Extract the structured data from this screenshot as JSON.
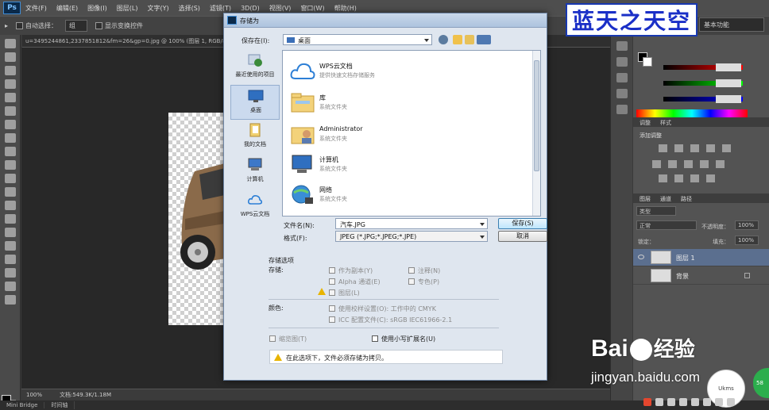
{
  "ps": {
    "menu": [
      "文件(F)",
      "编辑(E)",
      "图像(I)",
      "图层(L)",
      "文字(Y)",
      "选择(S)",
      "滤镜(T)",
      "3D(D)",
      "视图(V)",
      "窗口(W)",
      "帮助(H)"
    ],
    "options": {
      "auto_select": "自动选择：",
      "auto_select_value": "组",
      "show_transform": "显示变换控件"
    },
    "workspace": "基本功能",
    "doc_tab": "u=3495244861,2337851812&fm=26&gp=0.jpg @ 100% (图层 1, RGB/8)",
    "status_zoom": "100%",
    "status_doc": "文档:549.3K/1.18M",
    "bottom_tabs": [
      "Mini Bridge",
      "时间轴"
    ],
    "color_tabs": [
      "颜色",
      "色板"
    ],
    "adjust_tabs": [
      "调整",
      "样式"
    ],
    "adjust_title": "添加调整",
    "layers_tabs": [
      "图层",
      "通道",
      "路径"
    ],
    "layer_kind": "类型",
    "blend_mode": "正常",
    "opacity_label": "不透明度：",
    "opacity_value": "100%",
    "lock_label": "锁定：",
    "fill_label": "填充：",
    "fill_value": "100%",
    "layers": [
      {
        "name": "图层 1",
        "active": true
      },
      {
        "name": "背景",
        "active": false
      }
    ]
  },
  "dialog": {
    "title": "存储为",
    "save_in_label": "保存在(I):",
    "save_in_value": "桌面",
    "places": [
      {
        "label": "最近使用的项目",
        "icon": "recent-items-icon"
      },
      {
        "label": "桌面",
        "icon": "desktop-icon"
      },
      {
        "label": "我的文档",
        "icon": "documents-icon"
      },
      {
        "label": "计算机",
        "icon": "computer-icon"
      },
      {
        "label": "WPS云文档",
        "icon": "wps-cloud-icon"
      }
    ],
    "files": [
      {
        "name": "WPS云文档",
        "sub": "提供快速文档存储服务"
      },
      {
        "name": "库",
        "sub": "系统文件夹"
      },
      {
        "name": "Administrator",
        "sub": "系统文件夹"
      },
      {
        "name": "计算机",
        "sub": "系统文件夹"
      },
      {
        "name": "网络",
        "sub": "系统文件夹"
      }
    ],
    "filename_label": "文件名(N):",
    "filename_value": "汽车.JPG",
    "format_label": "格式(F):",
    "format_value": "JPEG (*.JPG;*.JPEG;*.JPE)",
    "save_button": "保存(S)",
    "cancel_button": "取消",
    "save_options_title": "存储选项",
    "save_label": "存储:",
    "as_copy": "作为副本(Y)",
    "notes": "注释(N)",
    "alpha": "Alpha 通道(E)",
    "spot": "专色(P)",
    "layers_opt": "图层(L)",
    "color_label": "颜色:",
    "proof": "使用校样设置(O): 工作中的 CMYK",
    "icc": "ICC 配置文件(C): sRGB IEC61966-2.1",
    "thumbnail": "缩览图(T)",
    "lowercase_ext": "使用小写扩展名(U)",
    "warning": "在此选项下，文件必须存储为拷贝。"
  },
  "watermark": {
    "logo": "蓝天之天空",
    "baidu_a": "Bai",
    "baidu_b": "经验",
    "baidu_url": "jingyan.baidu.com",
    "kms": "Ukms",
    "green": "58"
  }
}
